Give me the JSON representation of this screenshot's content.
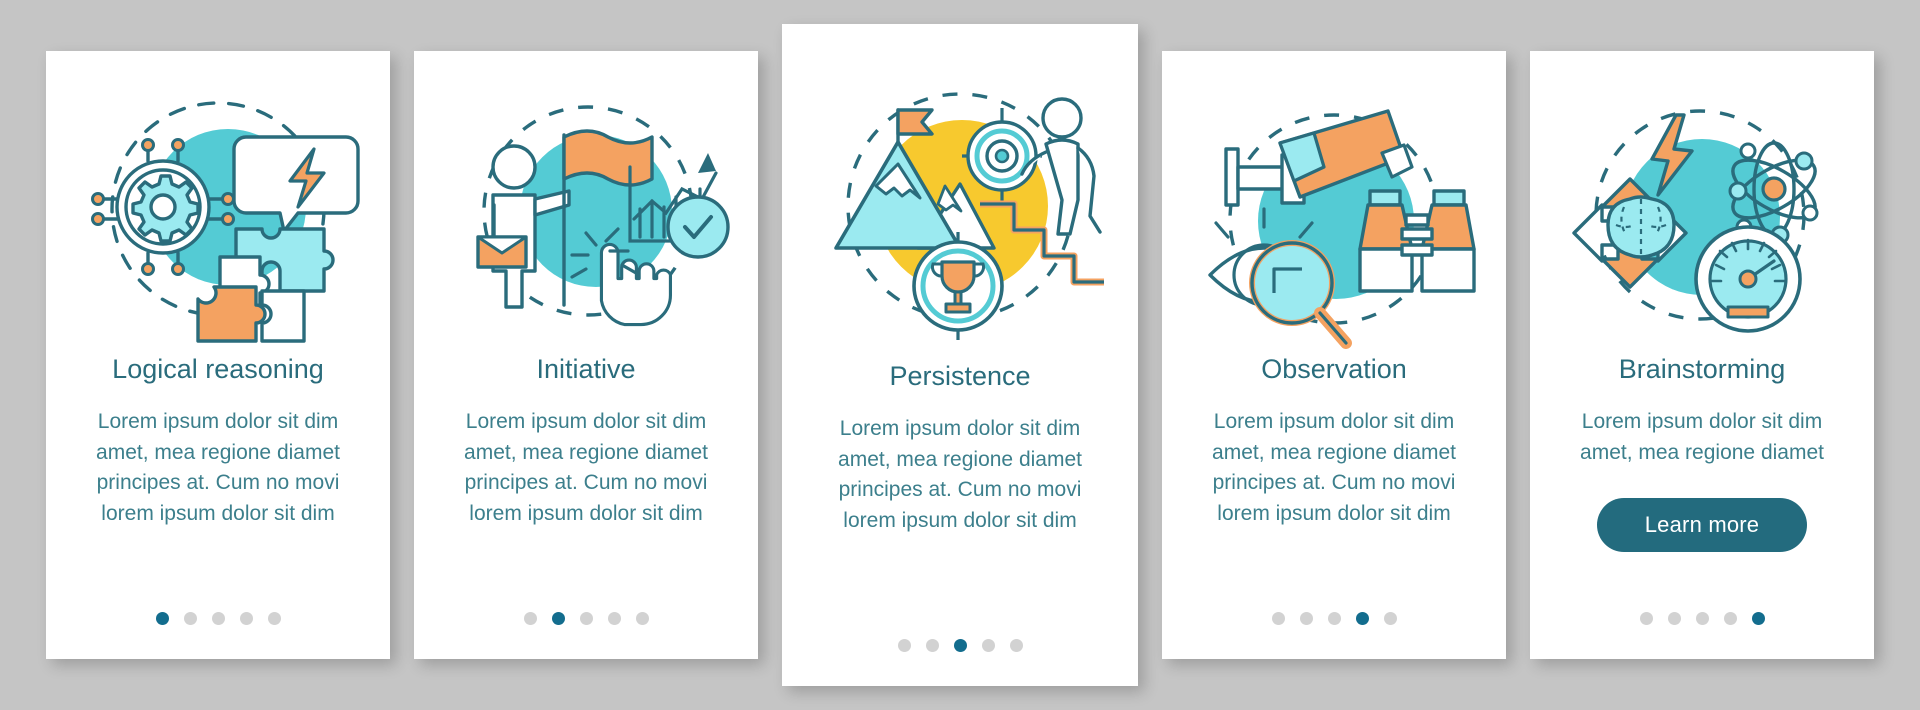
{
  "theme": {
    "background": "#c5c5c5",
    "card_background": "#ffffff",
    "title_color": "#2a6c7c",
    "body_color": "#3c7f8c",
    "accent_teal": "#54cbd4",
    "accent_teal_light": "#9beaf0",
    "accent_orange": "#f4a261",
    "accent_yellow": "#f7c92e",
    "stroke": "#2a6c7c",
    "dot_active": "#136d8e",
    "dot_inactive": "#d2d2d2",
    "button_background": "#236b7e",
    "button_text": "#ffffff"
  },
  "total_screens": 5,
  "screens": [
    {
      "id": "logical-reasoning",
      "title": "Logical reasoning",
      "body": "Lorem ipsum dolor sit dim\namet, mea regione diamet\nprincipes at. Cum no movi\nlorem ipsum dolor sit dim",
      "illustration": "gear-network-speech-bubble-puzzle-illustration",
      "circle_color": "#54cbd4",
      "active_dot": 1,
      "has_button": false,
      "tall": false
    },
    {
      "id": "initiative",
      "title": "Initiative",
      "body": "Lorem ipsum dolor sit dim\namet, mea regione diamet\nprincipes at. Cum no movi\nlorem ipsum dolor sit dim",
      "illustration": "person-flag-chart-checkmark-pointing-hand-illustration",
      "circle_color": "#54cbd4",
      "active_dot": 2,
      "has_button": false,
      "tall": false
    },
    {
      "id": "persistence",
      "title": "Persistence",
      "body": "Lorem ipsum dolor sit dim\namet, mea regione diamet\nprincipes at. Cum no movi\nlorem ipsum dolor sit dim",
      "illustration": "mountain-flag-target-stairs-trophy-illustration",
      "circle_color": "#f7c92e",
      "active_dot": 3,
      "has_button": false,
      "tall": true
    },
    {
      "id": "observation",
      "title": "Observation",
      "body": "Lorem ipsum dolor sit dim\namet, mea regione diamet\nprincipes at. Cum no movi\nlorem ipsum dolor sit dim",
      "illustration": "cctv-camera-eye-magnifier-binoculars-illustration",
      "circle_color": "#54cbd4",
      "active_dot": 4,
      "has_button": false,
      "tall": false
    },
    {
      "id": "brainstorming",
      "title": "Brainstorming",
      "body": "Lorem ipsum dolor sit dim\namet, mea regione diamet",
      "illustration": "brain-arrows-lightning-atom-speedometer-illustration",
      "circle_color": "#54cbd4",
      "active_dot": 5,
      "has_button": true,
      "button_label": "Learn more",
      "tall": false
    }
  ]
}
